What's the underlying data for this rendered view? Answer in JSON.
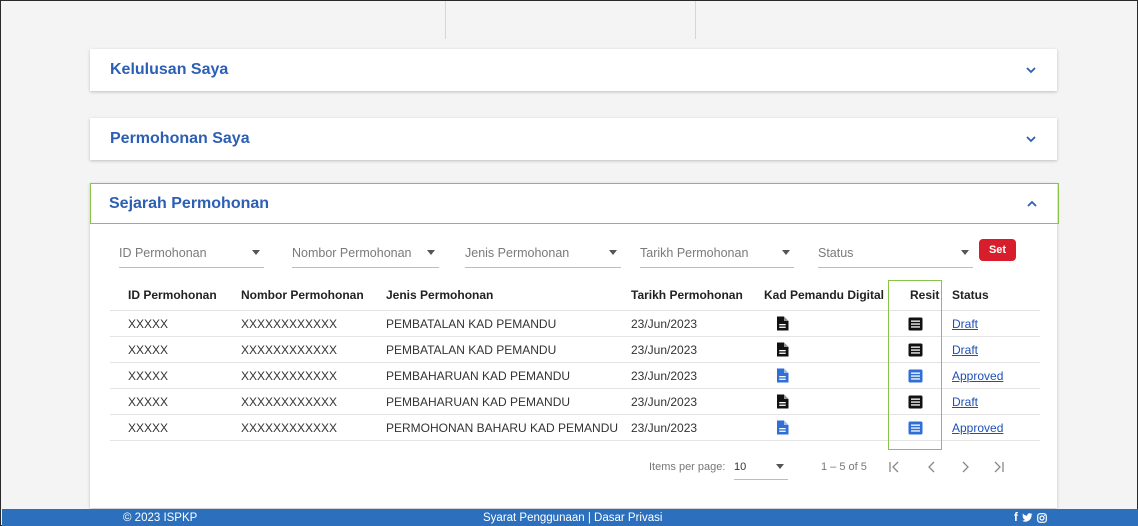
{
  "panels": {
    "kelulusan": {
      "title": "Kelulusan Saya"
    },
    "permohonan": {
      "title": "Permohonan Saya"
    },
    "sejarah": {
      "title": "Sejarah Permohonan"
    }
  },
  "filters": {
    "id": {
      "label": "ID Permohonan"
    },
    "nombor": {
      "label": "Nombor Permohonan"
    },
    "jenis": {
      "label": "Jenis Permohonan"
    },
    "tarikh": {
      "label": "Tarikh Permohonan"
    },
    "status": {
      "label": "Status"
    },
    "set_label": "Set"
  },
  "table": {
    "headers": [
      "ID Permohonan",
      "Nombor Permohonan",
      "Jenis Permohonan",
      "Tarikh Permohonan",
      "Kad Pemandu Digital",
      "Resit",
      "Status"
    ],
    "rows": [
      {
        "id": "XXXXX",
        "nombor": "XXXXXXXXXXXX",
        "jenis": "PEMBATALAN KAD PEMANDU",
        "tarikh": "23/Jun/2023",
        "kad_icon": "document-icon-black",
        "resit_icon": "receipt-icon-black",
        "status": "Draft"
      },
      {
        "id": "XXXXX",
        "nombor": "XXXXXXXXXXXX",
        "jenis": "PEMBATALAN KAD PEMANDU",
        "tarikh": "23/Jun/2023",
        "kad_icon": "document-icon-black",
        "resit_icon": "receipt-icon-black",
        "status": "Draft"
      },
      {
        "id": "XXXXX",
        "nombor": "XXXXXXXXXXXX",
        "jenis": "PEMBAHARUAN KAD PEMANDU",
        "tarikh": "23/Jun/2023",
        "kad_icon": "document-icon-blue",
        "resit_icon": "receipt-icon-blue",
        "status": "Approved"
      },
      {
        "id": "XXXXX",
        "nombor": "XXXXXXXXXXXX",
        "jenis": "PEMBAHARUAN KAD PEMANDU",
        "tarikh": "23/Jun/2023",
        "kad_icon": "document-icon-black",
        "resit_icon": "receipt-icon-black",
        "status": "Draft"
      },
      {
        "id": "XXXXX",
        "nombor": "XXXXXXXXXXXX",
        "jenis": "PERMOHONAN BAHARU KAD PEMANDU",
        "tarikh": "23/Jun/2023",
        "kad_icon": "document-icon-blue",
        "resit_icon": "receipt-icon-blue",
        "status": "Approved"
      }
    ]
  },
  "pager": {
    "items_label": "Items per page:",
    "page_size": "10",
    "range": "1 – 5 of 5"
  },
  "footer": {
    "copyright": "© 2023 ISPKP",
    "links": "Syarat Penggunaan | Dasar Privasi",
    "social": [
      "f",
      "t",
      "i"
    ]
  },
  "colors": {
    "accent_blue": "#2c5fb4",
    "icon_blue": "#2f6fd6",
    "set_red": "#d81e2c",
    "highlight_green": "#8bc34a",
    "footer_blue": "#2c6fbd"
  }
}
